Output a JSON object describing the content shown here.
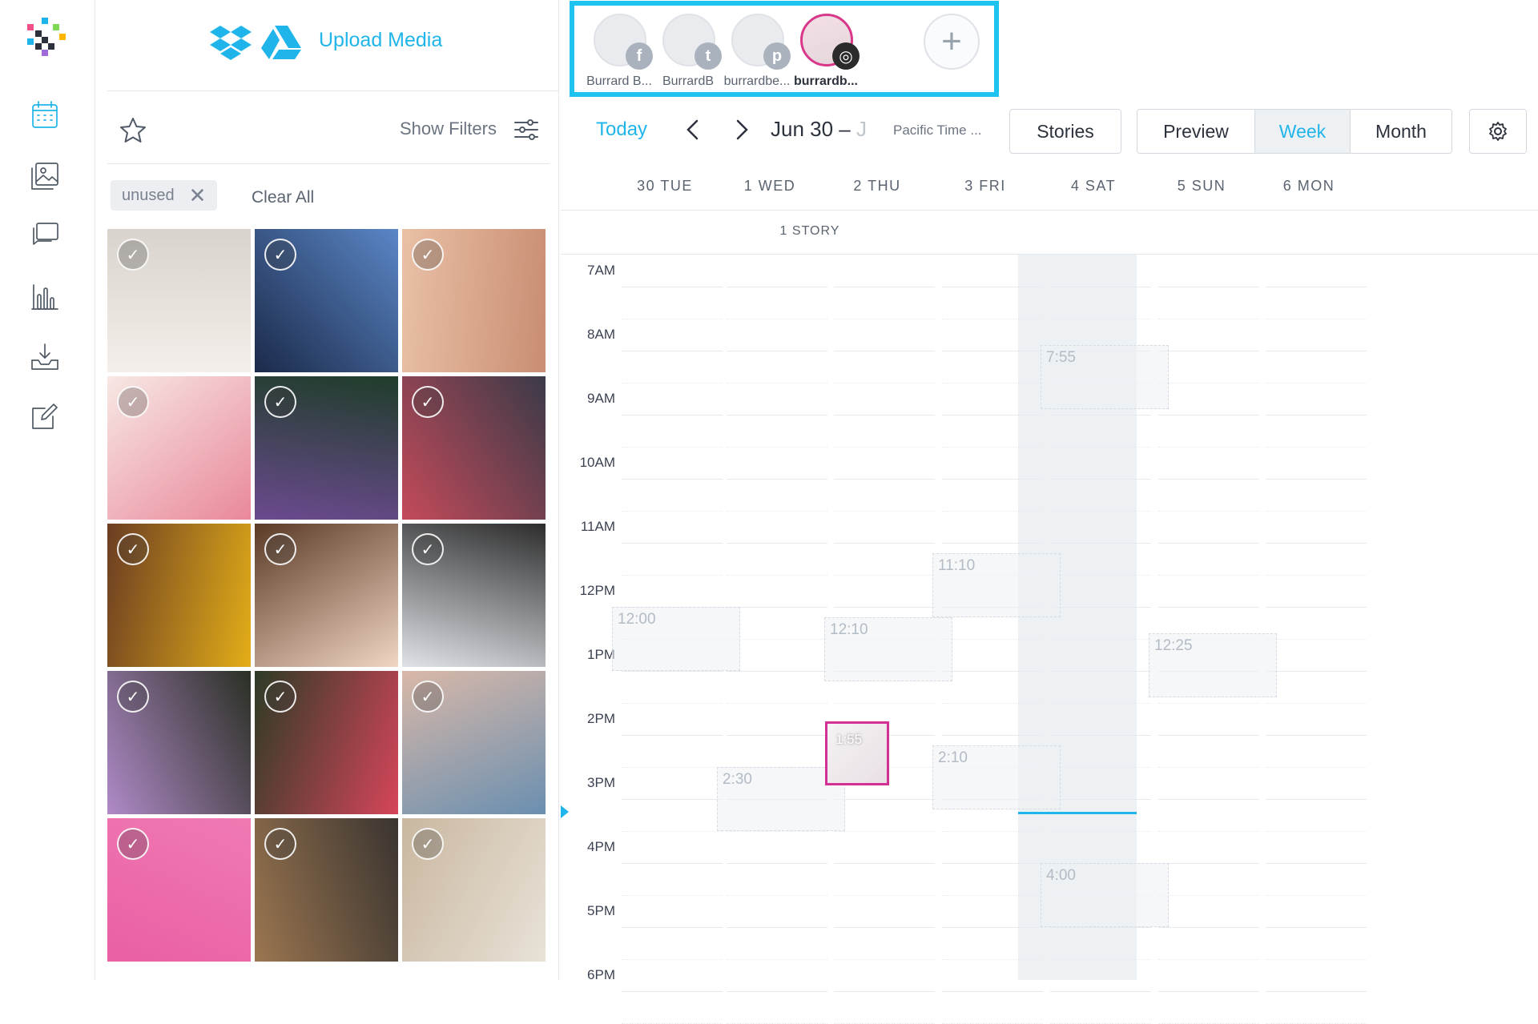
{
  "rail": {
    "items": [
      {
        "icon": "calendar-icon",
        "active": true
      },
      {
        "icon": "media-library-icon",
        "active": false
      },
      {
        "icon": "comments-icon",
        "active": false
      },
      {
        "icon": "analytics-icon",
        "active": false
      },
      {
        "icon": "inbox-download-icon",
        "active": false
      },
      {
        "icon": "edit-note-icon",
        "active": false
      }
    ]
  },
  "media": {
    "upload_label": "Upload Media",
    "show_filters_label": "Show Filters",
    "filter_chip": "unused",
    "clear_all_label": "Clear All",
    "thumbnails": [
      {
        "name": "white-rose-jar",
        "colors": [
          "#f4efea",
          "#d9d3cd"
        ]
      },
      {
        "name": "streetlight-sky",
        "colors": [
          "#1b2a4a",
          "#5a86c6"
        ]
      },
      {
        "name": "eye-closeup",
        "colors": [
          "#e9c0a6",
          "#c98e73"
        ]
      },
      {
        "name": "pink-roses",
        "colors": [
          "#f7e8e4",
          "#e9889a"
        ]
      },
      {
        "name": "purple-flowers",
        "colors": [
          "#1f3d2a",
          "#6b4a8f"
        ]
      },
      {
        "name": "protest-signs",
        "colors": [
          "#3b3a48",
          "#c44a5a"
        ]
      },
      {
        "name": "yellow-top-hands",
        "colors": [
          "#e3ae18",
          "#6b3d22"
        ]
      },
      {
        "name": "curly-hair-portrait",
        "colors": [
          "#f1d6c4",
          "#5a3a25"
        ]
      },
      {
        "name": "ladder-door",
        "colors": [
          "#dfe3e8",
          "#2d2d2d"
        ]
      },
      {
        "name": "purple-sky-palms",
        "colors": [
          "#b08ac8",
          "#2a2f24"
        ]
      },
      {
        "name": "flower-field-bouquet",
        "colors": [
          "#2d3b26",
          "#d6455a"
        ]
      },
      {
        "name": "mural-woman",
        "colors": [
          "#d9b8a8",
          "#6a8fb0"
        ]
      },
      {
        "name": "pink-makeup-brushes",
        "colors": [
          "#f07ab3",
          "#e95fa4"
        ]
      },
      {
        "name": "brushes-cup",
        "colors": [
          "#3a3430",
          "#9b7650"
        ]
      },
      {
        "name": "powder-compacts",
        "colors": [
          "#e8e2d8",
          "#c9b79f"
        ]
      }
    ]
  },
  "accounts": [
    {
      "name": "Burrard B...",
      "badge": "f",
      "badge_icon": "facebook-icon",
      "selected": false
    },
    {
      "name": "BurrardB",
      "badge": "t",
      "badge_icon": "twitter-icon",
      "selected": false
    },
    {
      "name": "burrardbe...",
      "badge": "p",
      "badge_icon": "pinterest-icon",
      "selected": false
    },
    {
      "name": "burrardb...",
      "badge": "◎",
      "badge_icon": "instagram-icon",
      "selected": true
    }
  ],
  "toolbar": {
    "today_label": "Today",
    "range_label": "Jun 30 – ",
    "range_fade": "J",
    "timezone": "Pacific Time ...",
    "stories_label": "Stories",
    "preview_label": "Preview",
    "week_label": "Week",
    "month_label": "Month"
  },
  "calendar": {
    "days": [
      "30 TUE",
      "1 WED",
      "2 THU",
      "3 FRI",
      "4 SAT",
      "5 SUN",
      "6 MON"
    ],
    "story_count": "1 STORY",
    "hours": [
      "7AM",
      "8AM",
      "9AM",
      "10AM",
      "11AM",
      "12PM",
      "1PM",
      "2PM",
      "3PM",
      "4PM",
      "5PM",
      "6PM"
    ],
    "slots": [
      {
        "day": 0,
        "time": "12:00"
      },
      {
        "day": 1,
        "time": "2:30"
      },
      {
        "day": 2,
        "time": "12:10"
      },
      {
        "day": 3,
        "time": "11:10"
      },
      {
        "day": 3,
        "time": "2:10"
      },
      {
        "day": 4,
        "time": "7:55"
      },
      {
        "day": 4,
        "time": "4:00"
      },
      {
        "day": 5,
        "time": "12:25"
      }
    ],
    "post": {
      "day": 2,
      "time": "1:55"
    }
  }
}
